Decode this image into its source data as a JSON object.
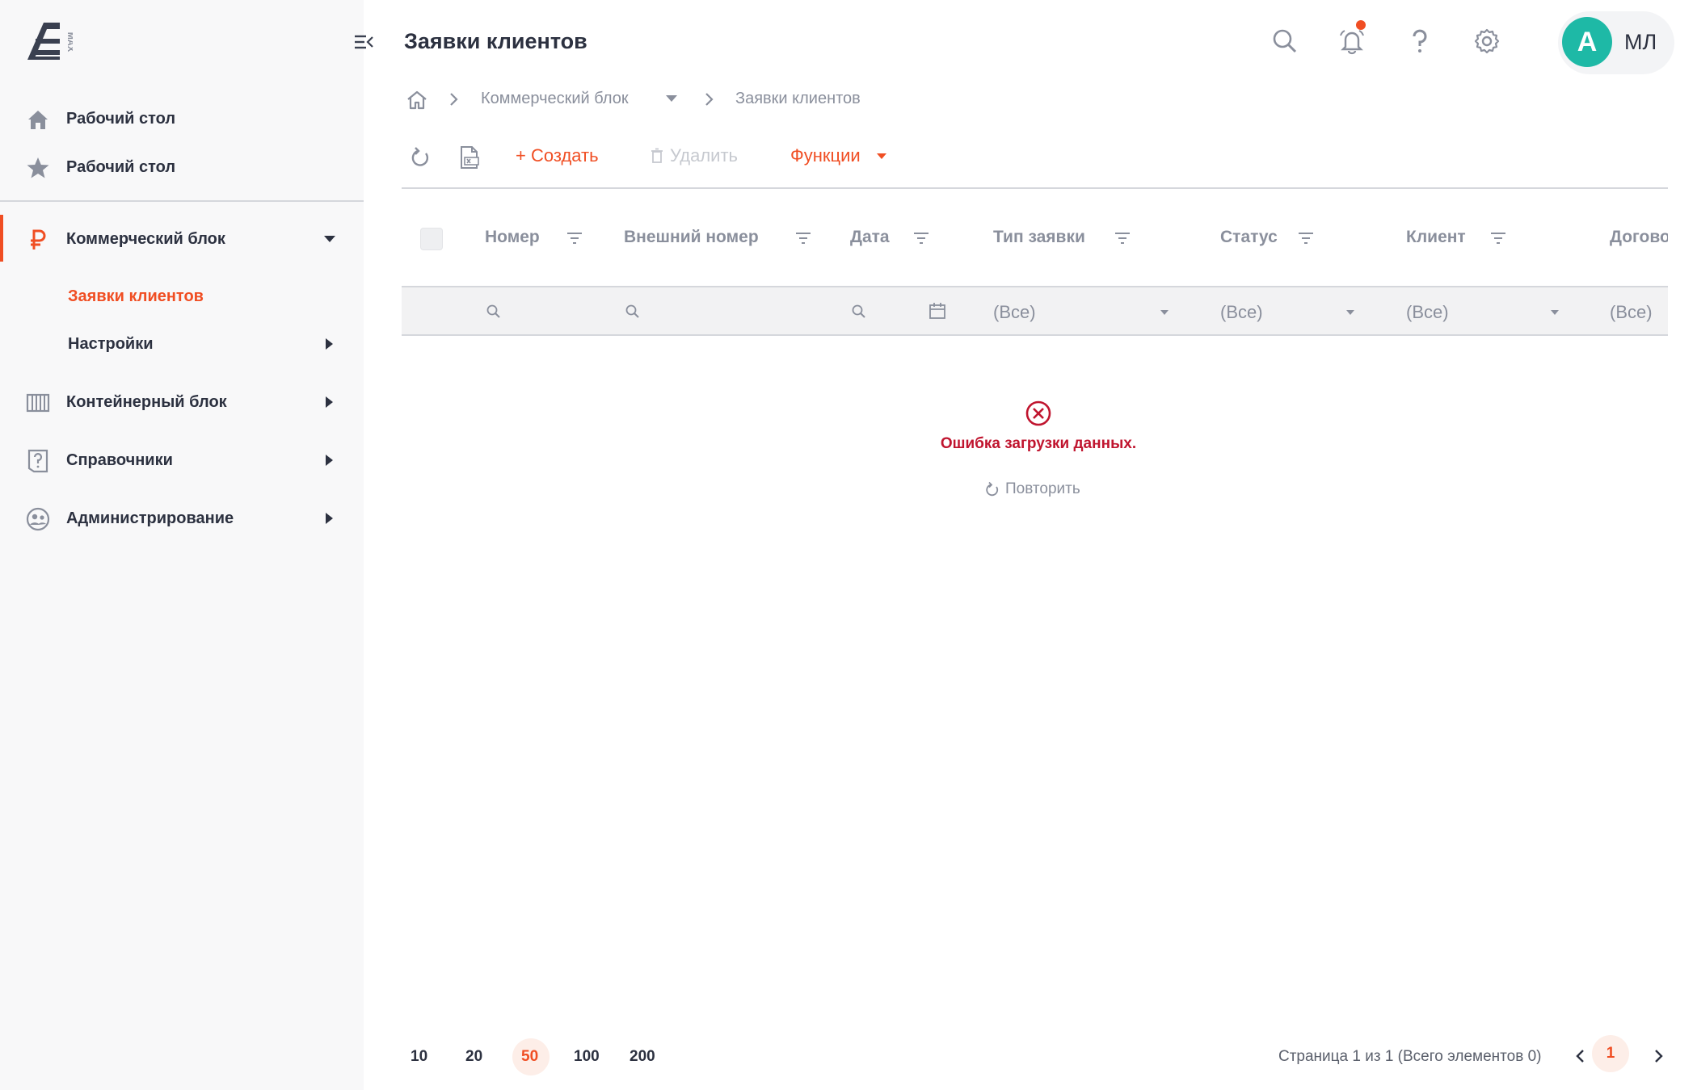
{
  "app": {
    "logo_text": "MAX",
    "user_avatar_letter": "A",
    "user_initials": "МЛ"
  },
  "colors": {
    "accent": "#f04e23",
    "error": "#c0152f",
    "avatar": "#1eb9a6"
  },
  "sidebar": {
    "items": [
      {
        "label": "Рабочий стол",
        "icon": "home-icon"
      },
      {
        "label": "Рабочий стол",
        "icon": "star-icon"
      },
      {
        "label": "Коммерческий блок",
        "icon": "ruble-icon"
      },
      {
        "label": "Контейнерный блок",
        "icon": "container-icon"
      },
      {
        "label": "Справочники",
        "icon": "question-book-icon"
      },
      {
        "label": "Администрирование",
        "icon": "admin-icon"
      }
    ],
    "sub_items": [
      {
        "label": "Заявки клиентов"
      },
      {
        "label": "Настройки"
      }
    ]
  },
  "header": {
    "title": "Заявки клиентов"
  },
  "breadcrumb": {
    "items": [
      "Коммерческий блок",
      "Заявки клиентов"
    ]
  },
  "toolbar": {
    "create_label": "+ Создать",
    "delete_label": "Удалить",
    "functions_label": "Функции"
  },
  "table": {
    "columns": [
      "Номер",
      "Внешний номер",
      "Дата",
      "Тип заявки",
      "Статус",
      "Клиент",
      "Договор"
    ],
    "filter_all": "(Все)"
  },
  "error": {
    "message": "Ошибка загрузки данных.",
    "retry_label": "Повторить"
  },
  "pagination": {
    "sizes": [
      "10",
      "20",
      "50",
      "100",
      "200"
    ],
    "active_size": "50",
    "status_text": "Страница 1 из 1  (Всего элементов 0)",
    "current_page": "1"
  }
}
